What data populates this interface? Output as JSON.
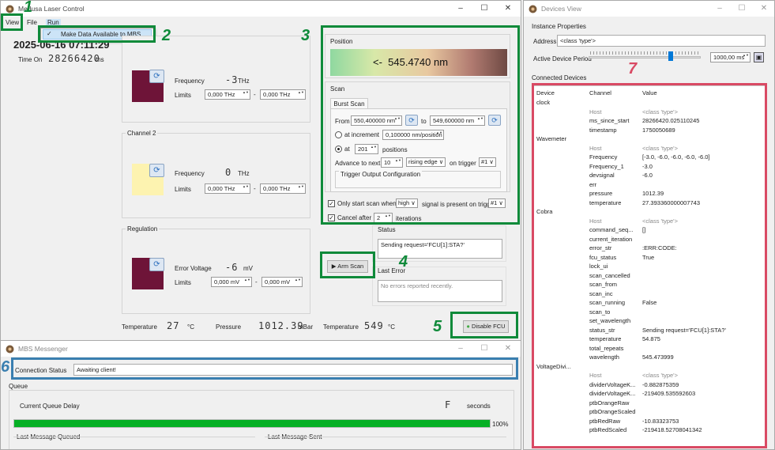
{
  "main_window": {
    "title": "Medusa Laser Control",
    "menu": [
      "View",
      "File",
      "Run"
    ],
    "menu_item": "Make Data Available to MBS",
    "date": "2025-06-16 07:11:29",
    "time_on_label": "Time On",
    "time_on_value": "28266420",
    "time_on_unit": "ms"
  },
  "channel1": {
    "title": "",
    "freq_label": "Frequency",
    "freq_value": "-3",
    "freq_unit": "THz",
    "limits_label": "Limits",
    "limit_low": "0,000 THz",
    "limit_high": "0,000 THz",
    "color": "#6e1438"
  },
  "channel2": {
    "title": "Channel 2",
    "freq_label": "Frequency",
    "freq_value": "0",
    "freq_unit": "THz",
    "limits_label": "Limits",
    "limit_low": "0,000 THz",
    "limit_high": "0,000 THz",
    "color": "#fdf3b0"
  },
  "regulation": {
    "title": "Regulation",
    "label": "Error Voltage",
    "value": "-6",
    "unit": "mV",
    "limits_label": "Limits",
    "limit_low": "0,000 mV",
    "limit_high": "0,000 mV",
    "color": "#6e1438"
  },
  "temps": {
    "temp_label": "Temperature",
    "temp_value": "27",
    "temp_unit": "°C",
    "pressure_label": "Pressure",
    "pressure_value": "1012.39",
    "pressure_unit": "mBar",
    "temp2_label": "Temperature",
    "temp2_value": "549",
    "temp2_unit": "°C"
  },
  "position": {
    "title": "Position",
    "readout": "<-  545.4740 nm"
  },
  "scan": {
    "title": "Scan",
    "tab": "Burst Scan",
    "from_label": "From",
    "from": "550,400000 nm",
    "to_label": "to",
    "to": "549,600000 nm",
    "inc_label": "at increment",
    "inc": "0,100000 nm/position",
    "at_label": "at",
    "at": "201",
    "positions": "positions",
    "advance": "Advance to next",
    "adv_n": "10",
    "edge": "rising edge",
    "on_trigger": "on trigger",
    "trig": "#1",
    "trig_cfg": "Trigger Output Configuration",
    "only_start": "Only start scan when",
    "level": "high",
    "signal": "signal is present on trigg",
    "trig2": "#1",
    "cancel": "Cancel after",
    "cancel_n": "2",
    "iterations": "iterations"
  },
  "status": {
    "title": "Status",
    "text": "Sending request='FCU[1]:STA?'",
    "last_error_title": "Last Error",
    "last_error": "No errors reported recently.",
    "arm": "Arm Scan",
    "disable": "Disable FCU"
  },
  "labels": {
    "l1": "1",
    "l2": "2",
    "l3": "3",
    "l4": "4",
    "l5": "5",
    "l6": "6",
    "l7": "7"
  },
  "mbs": {
    "title": "MBS Messenger",
    "conn_label": "Connection Status",
    "conn_value": "Awaiting client!",
    "queue": "Queue",
    "delay_label": "Current Queue Delay",
    "delay_value": "F",
    "delay_unit": "seconds",
    "progress": 1.0,
    "progress_text": "100%",
    "last_queued": "Last Message Queued",
    "last_sent": "Last Message Sent"
  },
  "devices": {
    "title": "Devices View",
    "inst_props": "Instance Properties",
    "address_label": "Address",
    "address": "<class 'type'>",
    "period_label": "Active Device Period",
    "period": "1000,00 ms",
    "period_fraction": 0.72,
    "connected": "Connected Devices",
    "headers": [
      "Device",
      "Channel",
      "Value"
    ],
    "rows": [
      [
        "clock",
        "",
        ""
      ],
      [
        "",
        "Host",
        "<class 'type'>"
      ],
      [
        "",
        "ms_since_start",
        "28266420.025110245"
      ],
      [
        "",
        "timestamp",
        "1750050689"
      ],
      [
        "Wavemeter",
        "",
        ""
      ],
      [
        "",
        "Host",
        "<class 'type'>"
      ],
      [
        "",
        "Frequency",
        "[-3.0, -6.0, -6.0, -6.0, -6.0]"
      ],
      [
        "",
        "Frequency_1",
        "-3.0"
      ],
      [
        "",
        "devsignal",
        "-6.0"
      ],
      [
        "",
        "err",
        ""
      ],
      [
        "",
        "pressure",
        "1012.39"
      ],
      [
        "",
        "temperature",
        "27.393360000007743"
      ],
      [
        "Cobra",
        "",
        ""
      ],
      [
        "",
        "Host",
        "<class 'type'>"
      ],
      [
        "",
        "command_seq...",
        "[]"
      ],
      [
        "",
        "current_iteration",
        ""
      ],
      [
        "",
        "error_str",
        ":ERR:CODE:"
      ],
      [
        "",
        "fcu_status",
        "True"
      ],
      [
        "",
        "lock_ui",
        ""
      ],
      [
        "",
        "scan_cancelled",
        ""
      ],
      [
        "",
        "scan_from",
        ""
      ],
      [
        "",
        "scan_inc",
        ""
      ],
      [
        "",
        "scan_running",
        "False"
      ],
      [
        "",
        "scan_to",
        ""
      ],
      [
        "",
        "set_wavelength",
        ""
      ],
      [
        "",
        "status_str",
        "Sending request='FCU[1]:STA?'"
      ],
      [
        "",
        "temperature",
        "54.875"
      ],
      [
        "",
        "total_repeats",
        ""
      ],
      [
        "",
        "wavelength",
        "545.473999"
      ],
      [
        "VoltageDivi...",
        "",
        ""
      ],
      [
        "",
        "Host",
        "<class 'type'>"
      ],
      [
        "",
        "dividerVoltageK...",
        "-0.882875359"
      ],
      [
        "",
        "dividerVoltageK...",
        "-219409.535592603"
      ],
      [
        "",
        "ptbOrangeRaw",
        ""
      ],
      [
        "",
        "ptbOrangeScaled",
        ""
      ],
      [
        "",
        "ptbRedRaw",
        "-10.83323753"
      ],
      [
        "",
        "ptbRedScaled",
        "-219418.52708041342"
      ]
    ]
  }
}
